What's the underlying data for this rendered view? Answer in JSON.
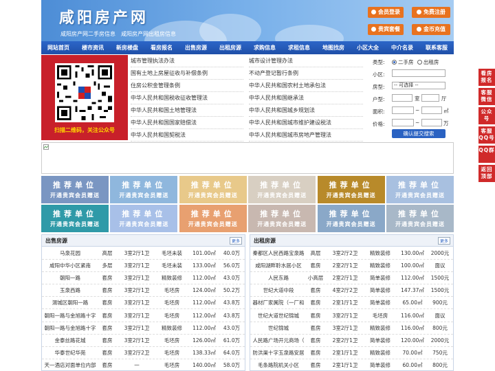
{
  "header": {
    "logo": "咸阳房产网",
    "subtitle_1": "咸阳房产网二手房信息",
    "subtitle_2": "咸阳房产网出租房信息",
    "buttons": [
      "会员登录",
      "免费注册",
      "贵宾套餐",
      "金币充值"
    ]
  },
  "nav": [
    "网站首页",
    "楼市资讯",
    "新房楼盘",
    "看房报名",
    "出售房源",
    "出租房源",
    "求购信息",
    "求租信息",
    "地图找房",
    "小区大全",
    "中介名录",
    "联系客服"
  ],
  "qr": {
    "caption": "扫描二维码，关注公众号"
  },
  "links": {
    "left": [
      "城市管理执法办法",
      "国有土地上房屋征收与补偿条例",
      "住房公积金管理条例",
      "中华人民共和国税收征收管理法",
      "中华人民共和国土地管理法",
      "中华人民共和国国家赔偿法",
      "中华人民共和国契税法"
    ],
    "right": [
      "城市设计管理办法",
      "不动产登记暂行条例",
      "中华人民共和国农村土地承包法",
      "中华人民共和国继承法",
      "中华人民共和国城乡规划法",
      "中华人民共和国城市维护建设税法",
      "中华人民共和国城市房地产管理法"
    ]
  },
  "search": {
    "type_label": "类型:",
    "radio_1": "二手房",
    "radio_2": "出租房",
    "community_label": "小区:",
    "room_label": "房型:",
    "room_value": "-- 可选择 --",
    "layout_label": "户型:",
    "layout_unit_1": "室",
    "layout_unit_2": "厅",
    "area_label": "面积:",
    "area_sep": "~",
    "area_unit": "㎡",
    "price_label": "价格:",
    "price_sep": "~",
    "price_unit": "万",
    "submit": "确认提交搜索"
  },
  "tiles": {
    "line1": "推荐单位",
    "line2": "开通贵宾会员赠送",
    "colors": [
      "#7a96c2",
      "#8fb7dd",
      "#e8c98a",
      "#d8cfc2",
      "#b88a2a",
      "#a8c0e0",
      "#2f9aa8",
      "#a8c0e8",
      "#e8a070",
      "#c8b8b0",
      "#8aa8c8",
      "#a8b8c8"
    ]
  },
  "sale": {
    "title": "出售房源",
    "more": "更多",
    "rows": [
      [
        "马泉花园",
        "高层",
        "3室2厅1卫",
        "毛坯未装",
        "101.00㎡",
        "40.0万"
      ],
      [
        "咸阳中华小区紧南",
        "多层",
        "3室2厅1卫",
        "毛坯未装",
        "133.00㎡",
        "56.0万"
      ],
      [
        "朝阳一路",
        "套房",
        "3室2厅1卫",
        "精致装修",
        "112.00㎡",
        "43.0万"
      ],
      [
        "玉泉西路",
        "套房",
        "3室2厅1卫",
        "毛坯房",
        "124.00㎡",
        "50.2万"
      ],
      [
        "渭城区朝阳一路",
        "套房",
        "3室2厅1卫",
        "毛坯房",
        "112.00㎡",
        "43.8万"
      ],
      [
        "朝阳一路与金旭路十字",
        "套房",
        "3室2厅1卫",
        "毛坯房",
        "112.00㎡",
        "43.8万"
      ],
      [
        "朝阳一路与金旭路十字",
        "套房",
        "3室2厅1卫",
        "精致装修",
        "112.00㎡",
        "43.0万"
      ],
      [
        "金泰丝路花城",
        "套房",
        "3室2厅1卫",
        "毛坯房",
        "126.00㎡",
        "61.0万"
      ],
      [
        "华泰世纪华苑",
        "套房",
        "3室2厅2卫",
        "毛坯房",
        "138.33㎡",
        "64.0万"
      ],
      [
        "天一酒店对面单位内部",
        "套房",
        "一",
        "毛坯房",
        "140.00㎡",
        "58.0万"
      ]
    ]
  },
  "rent": {
    "title": "出租房源",
    "more": "更多",
    "rows": [
      [
        "秦都区人民西路宝泉路",
        "高层",
        "3室2厅2卫",
        "精致装修",
        "130.00㎡",
        "2000元"
      ],
      [
        "咸阳湖畔聆水居小区",
        "套房",
        "2室2厅1卫",
        "精致装修",
        "100.00㎡",
        "面议"
      ],
      [
        "人民东路",
        "小高层",
        "2室2厅1卫",
        "简单装修",
        "112.00㎡",
        "1500元"
      ],
      [
        "世纪大道中段",
        "套房",
        "4室2厅2卫",
        "简单装修",
        "147.37㎡",
        "1500元"
      ],
      [
        "器材厂家属院（一厂和",
        "套房",
        "2室1厅1卫",
        "简单装修",
        "65.00㎡",
        "900元"
      ],
      [
        "世纪大道世纪锦城",
        "套房",
        "3室2厅1卫",
        "毛坯房",
        "116.00㎡",
        "面议"
      ],
      [
        "世纪锦城",
        "套房",
        "3室2厅1卫",
        "精致装修",
        "116.00㎡",
        "800元"
      ],
      [
        "人民路广场开元商场（",
        "套房",
        "2室2厅1卫",
        "简单装修",
        "120.00㎡",
        "2000元"
      ],
      [
        "防洪渠十字玉泉路安居",
        "套房",
        "2室1厅1卫",
        "精致装修",
        "70.00㎡",
        "750元"
      ],
      [
        "毛条路院机关小区",
        "套房",
        "2室1厅1卫",
        "简单装修",
        "60.00㎡",
        "800元"
      ]
    ]
  },
  "sidebar": [
    "看房报名",
    "客服微信",
    "公众号",
    "客服QQ号",
    "QQ群",
    "返回顶部"
  ]
}
